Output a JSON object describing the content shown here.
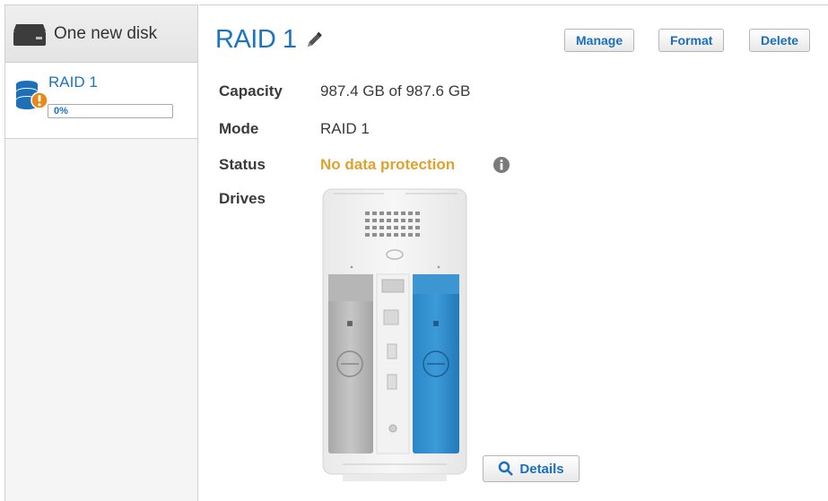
{
  "sidebar": {
    "new_disk_label": "One new disk",
    "raid_item": {
      "name": "RAID 1",
      "progress_text": "0%",
      "progress": 0
    }
  },
  "main": {
    "title": "RAID 1",
    "buttons": {
      "manage": "Manage",
      "format": "Format",
      "delete": "Delete"
    },
    "properties": {
      "capacity_label": "Capacity",
      "capacity_value": "987.4 GB of 987.6 GB",
      "mode_label": "Mode",
      "mode_value": "RAID 1",
      "status_label": "Status",
      "status_value": "No data protection",
      "drives_label": "Drives"
    },
    "details_button": "Details"
  },
  "colors": {
    "accent": "#1a73c7",
    "warning": "#e0a22c",
    "drive_active": "#2f8fcf",
    "drive_inactive": "#b9b9b9"
  },
  "icons": {
    "new_disk": "drive-icon",
    "raid_item": "raid-warning-icon",
    "edit": "pencil-icon",
    "info": "info-icon",
    "details": "magnifier-icon"
  }
}
